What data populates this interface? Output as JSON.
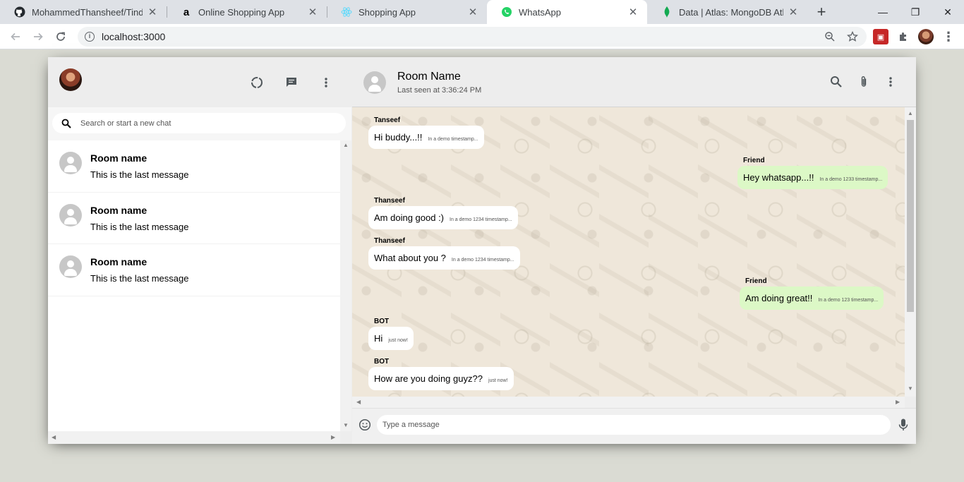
{
  "browser": {
    "tabs": [
      {
        "title": "MohammedThansheef/Tinder-",
        "favicon": "github-icon"
      },
      {
        "title": "Online Shopping App",
        "favicon": "amazon-icon"
      },
      {
        "title": "Shopping App",
        "favicon": "react-icon"
      },
      {
        "title": "WhatsApp",
        "favicon": "whatsapp-icon",
        "active": true
      },
      {
        "title": "Data | Atlas: MongoDB Atlas",
        "favicon": "mongodb-leaf-icon"
      }
    ],
    "url": "localhost:3000"
  },
  "sidebar": {
    "search_placeholder": "Search or start a new chat",
    "chats": [
      {
        "name": "Room name",
        "last_message": "This is the last message"
      },
      {
        "name": "Room name",
        "last_message": "This is the last message"
      },
      {
        "name": "Room name",
        "last_message": "This is the last message"
      }
    ]
  },
  "chat": {
    "room_name": "Room Name",
    "last_seen": "Last seen at 3:36:24 PM",
    "messages": [
      {
        "name": "Tanseef",
        "text": "Hi buddy...!!",
        "timestamp": "In a demo timestamp...",
        "mine": false
      },
      {
        "name": "Friend",
        "text": "Hey whatsapp...!!",
        "timestamp": "In a demo 1233 timestamp...",
        "mine": true
      },
      {
        "name": "Thanseef",
        "text": "Am doing good :)",
        "timestamp": "In a demo 1234 timestamp...",
        "mine": false
      },
      {
        "name": "Thanseef",
        "text": "What about you ?",
        "timestamp": "In a demo 1234 timestamp...",
        "mine": false
      },
      {
        "name": "Friend",
        "text": "Am doing great!!",
        "timestamp": "In a demo 123 timestamp...",
        "mine": true
      },
      {
        "name": "BOT",
        "text": "Hi",
        "timestamp": "just now!",
        "mine": false
      },
      {
        "name": "BOT",
        "text": "How are you doing guyz??",
        "timestamp": "just now!",
        "mine": false
      }
    ],
    "input_placeholder": "Type a message"
  },
  "colors": {
    "sent_bubble": "#dcf8c6",
    "received_bubble": "#ffffff",
    "chat_background": "#efe7da",
    "header_bg": "#ededed"
  }
}
